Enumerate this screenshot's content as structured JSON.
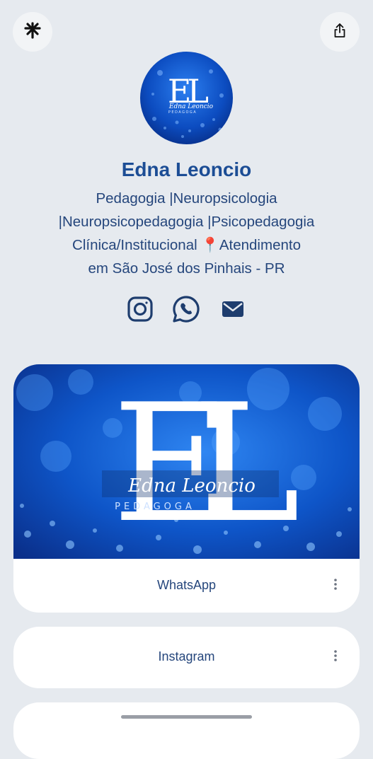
{
  "header": {
    "logo_icon": "linktree-asterisk-icon",
    "share_icon": "share-icon"
  },
  "profile": {
    "name": "Edna Leoncio",
    "avatar_monogram": "EL",
    "avatar_script": "Edna Leoncio",
    "avatar_subtitle": "PEDAGOGA",
    "bio_lines": [
      "Pedagogia |Neuropsicologia",
      "|Neuropsicopedagogia |Psicopedagogia",
      "Clínica/Institucional 📍Atendimento",
      "em São José dos Pinhais - PR"
    ]
  },
  "socials": [
    {
      "icon": "instagram-icon"
    },
    {
      "icon": "whatsapp-icon"
    },
    {
      "icon": "mail-icon"
    }
  ],
  "links": [
    {
      "label": "WhatsApp",
      "banner": {
        "monogram": "EL",
        "script": "Edna Leoncio",
        "subtitle": "PEDAGOGA"
      }
    },
    {
      "label": "Instagram"
    },
    {
      "label": ""
    }
  ],
  "colors": {
    "background": "#e6eaef",
    "name": "#1c4d95",
    "text": "#25467c",
    "banner_blue": "#0d4fbf"
  }
}
